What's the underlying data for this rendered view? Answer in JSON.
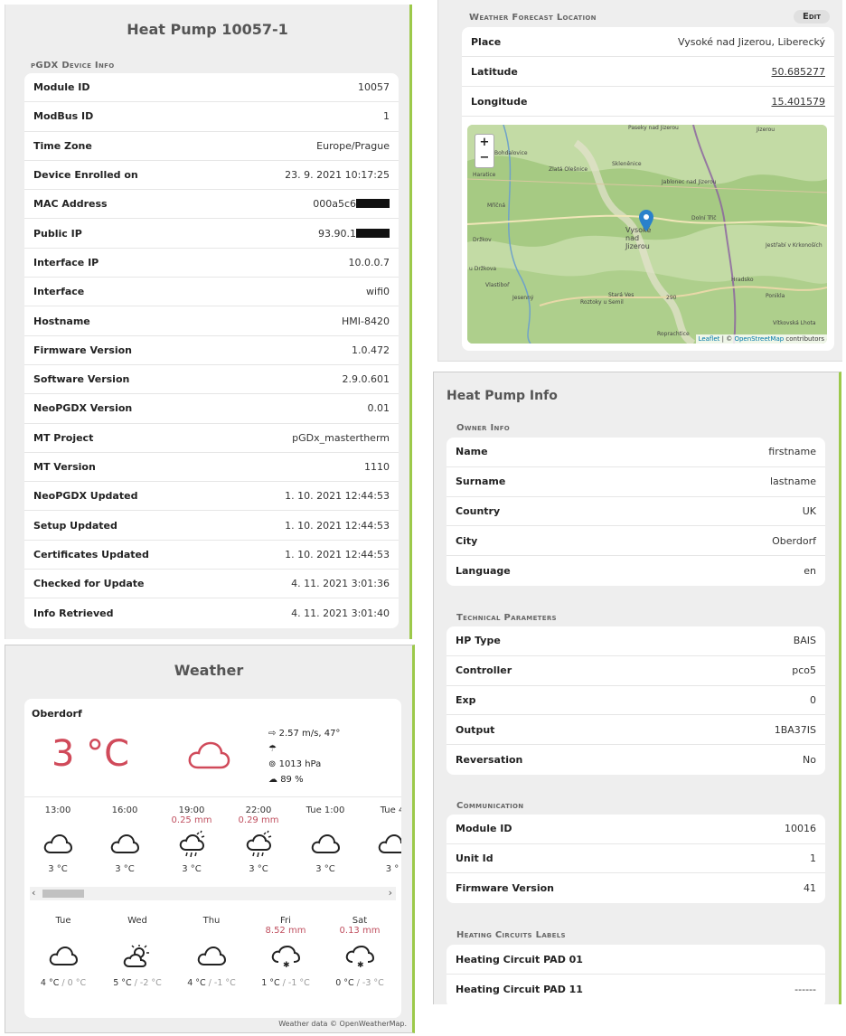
{
  "device": {
    "title": "Heat Pump 10057-1",
    "section": "pGDX Device Info",
    "rows": [
      {
        "label": "Module ID",
        "value": "10057"
      },
      {
        "label": "ModBus ID",
        "value": "1"
      },
      {
        "label": "Time Zone",
        "value": "Europe/Prague"
      },
      {
        "label": "Device Enrolled on",
        "value": "23. 9. 2021 10:17:25"
      },
      {
        "label": "MAC Address",
        "value": "000a5c6"
      },
      {
        "label": "Public IP",
        "value": "93.90.1"
      },
      {
        "label": "Interface IP",
        "value": "10.0.0.7"
      },
      {
        "label": "Interface",
        "value": "wifi0"
      },
      {
        "label": "Hostname",
        "value": "HMI-8420"
      },
      {
        "label": "Firmware Version",
        "value": "1.0.472"
      },
      {
        "label": "Software Version",
        "value": "2.9.0.601"
      },
      {
        "label": "NeoPGDX Version",
        "value": "0.01"
      },
      {
        "label": "MT Project",
        "value": "pGDx_mastertherm"
      },
      {
        "label": "MT Version",
        "value": "1110"
      },
      {
        "label": "NeoPGDX Updated",
        "value": "1. 10. 2021 12:44:53"
      },
      {
        "label": "Setup Updated",
        "value": "1. 10. 2021 12:44:53"
      },
      {
        "label": "Certificates Updated",
        "value": "1. 10. 2021 12:44:53"
      },
      {
        "label": "Checked for Update",
        "value": "4. 11. 2021 3:01:36"
      },
      {
        "label": "Info Retrieved",
        "value": "4. 11. 2021 3:01:40"
      }
    ]
  },
  "forecast_location": {
    "section": "Weather Forecast Location",
    "edit_label": "Edit",
    "place_label": "Place",
    "place_value": "Vysoké nad Jizerou, Liberecký",
    "lat_label": "Latitude",
    "lat_value": "50.685277",
    "lon_label": "Longitude",
    "lon_value": "15.401579",
    "map": {
      "zoom_in": "+",
      "zoom_out": "−",
      "attribution_leaflet": "Leaflet",
      "attribution_rest": " | © ",
      "attribution_osm": "OpenStreetMap",
      "attribution_tail": " contributors",
      "place_names": [
        "Paseky nad Jizerou",
        "Jizerou",
        "Bohdalovice",
        "Zlatá Olešnice",
        "Haratice",
        "Skleněnice",
        "Jablonec nad Jizerou",
        "Mříčná",
        "Vysoké nad Jizerou",
        "Dolní Tříč",
        "Držkov",
        "u Držkova",
        "Vlastiboř",
        "Stará Ves",
        "Jestřabí v Krkonoších",
        "Hradsko",
        "Ponikla",
        "Jesenný",
        "Roztoky u Semil",
        "290",
        "Roprachtice",
        "Vítkovská Lhota"
      ]
    }
  },
  "weather": {
    "title": "Weather",
    "city": "Oberdorf",
    "temp": "3 °C",
    "wind": "2.57 m/s, 47°",
    "pressure": "1013 hPa",
    "humidity": "89 %",
    "hourly": [
      {
        "time": "13:00",
        "rain": "",
        "temp": "3 °C",
        "icon": "cloud-icon"
      },
      {
        "time": "16:00",
        "rain": "",
        "temp": "3 °C",
        "icon": "cloud-icon"
      },
      {
        "time": "19:00",
        "rain": "0.25 mm",
        "temp": "3 °C",
        "icon": "cloud-rain-sun-icon"
      },
      {
        "time": "22:00",
        "rain": "0.29 mm",
        "temp": "3 °C",
        "icon": "cloud-rain-sun-icon"
      },
      {
        "time": "Tue 1:00",
        "rain": "",
        "temp": "3 °C",
        "icon": "cloud-icon"
      },
      {
        "time": "Tue 4",
        "rain": "",
        "temp": "3 °",
        "icon": "cloud-icon"
      }
    ],
    "daily": [
      {
        "day": "Tue",
        "rain": "",
        "high": "4 °C",
        "low": "0 °C",
        "icon": "cloud-icon"
      },
      {
        "day": "Wed",
        "rain": "",
        "high": "5 °C",
        "low": "-2 °C",
        "icon": "sun-cloud-icon"
      },
      {
        "day": "Thu",
        "rain": "",
        "high": "4 °C",
        "low": "-1 °C",
        "icon": "cloud-icon"
      },
      {
        "day": "Fri",
        "rain": "8.52 mm",
        "high": "1 °C",
        "low": "-1 °C",
        "icon": "cloud-snow-icon"
      },
      {
        "day": "Sat",
        "rain": "0.13 mm",
        "high": "0 °C",
        "low": "-3 °C",
        "icon": "cloud-snow-icon"
      }
    ],
    "footer": "Weather data © OpenWeatherMap."
  },
  "hp_info": {
    "title": "Heat Pump Info",
    "owner_section": "Owner Info",
    "owner_rows": [
      {
        "label": "Name",
        "value": "firstname"
      },
      {
        "label": "Surname",
        "value": "lastname"
      },
      {
        "label": "Country",
        "value": "UK"
      },
      {
        "label": "City",
        "value": "Oberdorf"
      },
      {
        "label": "Language",
        "value": "en"
      }
    ],
    "tech_section": "Technical Parameters",
    "tech_rows": [
      {
        "label": "HP Type",
        "value": "BAIS"
      },
      {
        "label": "Controller",
        "value": "pco5"
      },
      {
        "label": "Exp",
        "value": "0"
      },
      {
        "label": "Output",
        "value": "1BA37IS"
      },
      {
        "label": "Reversation",
        "value": "No"
      }
    ],
    "comm_section": "Communication",
    "comm_rows": [
      {
        "label": "Module ID",
        "value": "10016"
      },
      {
        "label": "Unit Id",
        "value": "1"
      },
      {
        "label": "Firmware Version",
        "value": "41"
      }
    ],
    "circuits_section": "Heating Circuits Labels",
    "circuit_rows": [
      {
        "label": "Heating Circuit PAD 01",
        "value": ""
      },
      {
        "label": "Heating Circuit PAD 11",
        "value": "------"
      }
    ]
  }
}
